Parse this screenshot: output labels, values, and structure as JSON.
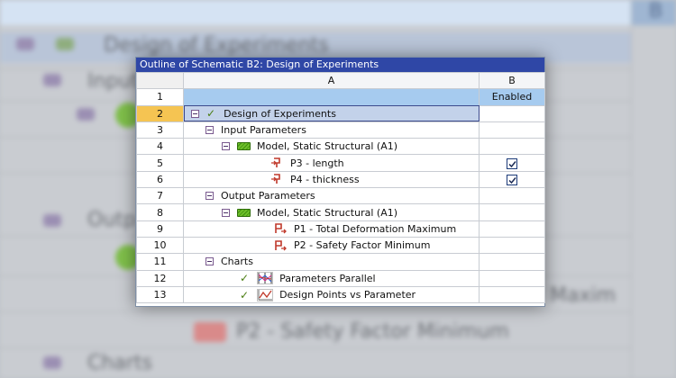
{
  "background_text": {
    "line1": "Design of Experiments",
    "line2": "Input",
    "line3": "Outp",
    "line4": "Maxim",
    "line5": "P2 - Safety Factor Minimum",
    "line6": "Charts",
    "corner": "B"
  },
  "panel": {
    "title": "Outline of Schematic B2: Design of Experiments",
    "col_a_header": "A",
    "col_b_header": "B",
    "col_b_sub": "Enabled"
  },
  "rows": [
    {
      "num": "1",
      "label": ""
    },
    {
      "num": "2",
      "label": "Design of Experiments",
      "icon": "check-icon",
      "selected": true
    },
    {
      "num": "3",
      "label": "Input Parameters"
    },
    {
      "num": "4",
      "label": "Model, Static Structural (A1)",
      "icon": "model-icon"
    },
    {
      "num": "5",
      "label": "P3 - length",
      "icon": "input-parameter-icon",
      "enabled": true
    },
    {
      "num": "6",
      "label": "P4 - thickness",
      "icon": "input-parameter-icon",
      "enabled": true
    },
    {
      "num": "7",
      "label": "Output Parameters"
    },
    {
      "num": "8",
      "label": "Model, Static Structural (A1)",
      "icon": "model-icon"
    },
    {
      "num": "9",
      "label": "P1 - Total Deformation Maximum",
      "icon": "output-parameter-icon"
    },
    {
      "num": "10",
      "label": "P2 - Safety Factor Minimum",
      "icon": "output-parameter-icon"
    },
    {
      "num": "11",
      "label": "Charts"
    },
    {
      "num": "12",
      "label": "Parameters Parallel",
      "icon": "parallel-chart-icon"
    },
    {
      "num": "13",
      "label": "Design Points vs Parameter",
      "icon": "line-chart-icon"
    }
  ],
  "colors": {
    "title_bar": "#2f47a6",
    "selected_row_number": "#f5c452",
    "enabled_header": "#a6cbef"
  }
}
